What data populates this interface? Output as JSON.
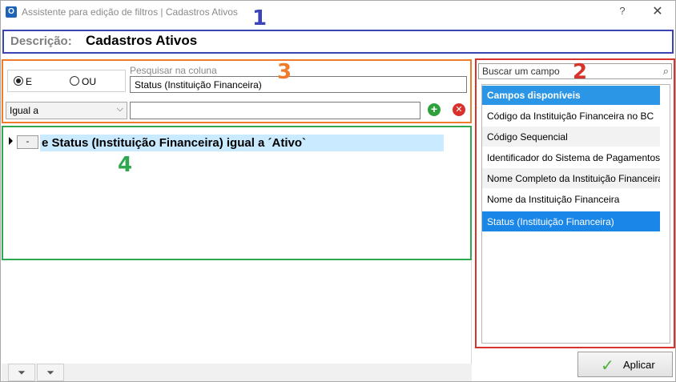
{
  "window": {
    "title": "Assistente para edição de filtros | Cadastros Ativos",
    "help_label": "?",
    "close_label": "✕"
  },
  "annotations": [
    "1",
    "2",
    "3",
    "4"
  ],
  "description": {
    "label": "Descrição:",
    "value": "Cadastros Ativos"
  },
  "filter": {
    "radio_e": "E",
    "radio_ou": "OU",
    "selected_radio": "E",
    "search_column_label": "Pesquisar na coluna",
    "search_column_value": "Status (Instituição Financeira)",
    "operator_value": "Igual a",
    "value_input": ""
  },
  "tree": {
    "toggle_label": "-",
    "node_label": "e Status (Instituição Financeira) igual a ´Ativo`"
  },
  "fields": {
    "search_placeholder": "Buscar um campo",
    "header": "Campos disponíveis",
    "items": [
      "Código da Instituição Financeira no BC",
      "Código Sequencial",
      "Identificador do Sistema de Pagamentos",
      "Nome Completo da Instituição Financeira",
      "Nome da Instituição Financeira",
      "Status (Instituição Financeira)"
    ],
    "selected_index": 5
  },
  "apply_label": "Aplicar",
  "colors": {
    "annotation_1": "#3a44b7",
    "annotation_2": "#d8342b",
    "annotation_3": "#f07c2b",
    "annotation_4": "#2fa84f",
    "selection": "#1a86e8"
  }
}
